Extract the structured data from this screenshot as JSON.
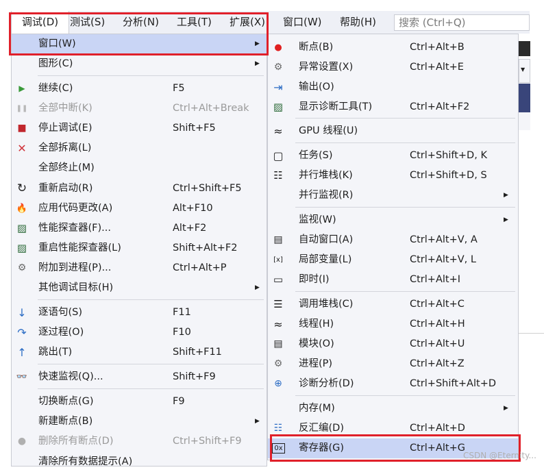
{
  "menubar": {
    "items": [
      {
        "label": "调试(D)"
      },
      {
        "label": "测试(S)"
      },
      {
        "label": "分析(N)"
      },
      {
        "label": "工具(T)"
      },
      {
        "label": "扩展(X)"
      },
      {
        "label": "窗口(W)"
      },
      {
        "label": "帮助(H)"
      }
    ],
    "search_placeholder": "搜索 (Ctrl+Q)"
  },
  "debug_menu": {
    "items": [
      {
        "label": "窗口(W)",
        "shortcut": "",
        "icon": "",
        "submenu": true
      },
      {
        "label": "图形(C)",
        "shortcut": "",
        "icon": "",
        "submenu": true
      },
      {
        "label": "继续(C)",
        "shortcut": "F5",
        "icon": "play-icon"
      },
      {
        "label": "全部中断(K)",
        "shortcut": "Ctrl+Alt+Break",
        "icon": "pause-icon"
      },
      {
        "label": "停止调试(E)",
        "shortcut": "Shift+F5",
        "icon": "stop-icon"
      },
      {
        "label": "全部拆离(L)",
        "shortcut": "",
        "icon": "close-icon"
      },
      {
        "label": "全部终止(M)",
        "shortcut": "",
        "icon": ""
      },
      {
        "label": "重新启动(R)",
        "shortcut": "Ctrl+Shift+F5",
        "icon": "restart-icon"
      },
      {
        "label": "应用代码更改(A)",
        "shortcut": "Alt+F10",
        "icon": "hot-reload-icon"
      },
      {
        "label": "性能探查器(F)...",
        "shortcut": "Alt+F2",
        "icon": "profiler-icon"
      },
      {
        "label": "重启性能探查器(L)",
        "shortcut": "Shift+Alt+F2",
        "icon": "profiler-restart-icon"
      },
      {
        "label": "附加到进程(P)...",
        "shortcut": "Ctrl+Alt+P",
        "icon": "attach-process-icon"
      },
      {
        "label": "其他调试目标(H)",
        "shortcut": "",
        "icon": "",
        "submenu": true
      },
      {
        "label": "逐语句(S)",
        "shortcut": "F11",
        "icon": "step-into-icon"
      },
      {
        "label": "逐过程(O)",
        "shortcut": "F10",
        "icon": "step-over-icon"
      },
      {
        "label": "跳出(T)",
        "shortcut": "Shift+F11",
        "icon": "step-out-icon"
      },
      {
        "label": "快速监视(Q)...",
        "shortcut": "Shift+F9",
        "icon": "quick-watch-icon"
      },
      {
        "label": "切换断点(G)",
        "shortcut": "F9",
        "icon": ""
      },
      {
        "label": "新建断点(B)",
        "shortcut": "",
        "icon": "",
        "submenu": true
      },
      {
        "label": "删除所有断点(D)",
        "shortcut": "Ctrl+Shift+F9",
        "icon": "delete-breakpoints-icon"
      },
      {
        "label": "清除所有数据提示(A)",
        "shortcut": "",
        "icon": ""
      }
    ]
  },
  "window_submenu": {
    "items": [
      {
        "label": "断点(B)",
        "shortcut": "Ctrl+Alt+B",
        "icon": "breakpoint-icon"
      },
      {
        "label": "异常设置(X)",
        "shortcut": "Ctrl+Alt+E",
        "icon": "exception-settings-icon"
      },
      {
        "label": "输出(O)",
        "shortcut": "",
        "icon": "output-icon"
      },
      {
        "label": "显示诊断工具(T)",
        "shortcut": "Ctrl+Alt+F2",
        "icon": "diagnostic-tools-icon"
      },
      {
        "label": "GPU 线程(U)",
        "shortcut": "",
        "icon": "gpu-threads-icon"
      },
      {
        "label": "任务(S)",
        "shortcut": "Ctrl+Shift+D, K",
        "icon": "tasks-icon"
      },
      {
        "label": "并行堆栈(K)",
        "shortcut": "Ctrl+Shift+D, S",
        "icon": "parallel-stacks-icon"
      },
      {
        "label": "并行监视(R)",
        "shortcut": "",
        "icon": "",
        "submenu": true
      },
      {
        "label": "监视(W)",
        "shortcut": "",
        "icon": "",
        "submenu": true
      },
      {
        "label": "自动窗口(A)",
        "shortcut": "Ctrl+Alt+V, A",
        "icon": "autos-icon"
      },
      {
        "label": "局部变量(L)",
        "shortcut": "Ctrl+Alt+V, L",
        "icon": "locals-icon"
      },
      {
        "label": "即时(I)",
        "shortcut": "Ctrl+Alt+I",
        "icon": "immediate-icon"
      },
      {
        "label": "调用堆栈(C)",
        "shortcut": "Ctrl+Alt+C",
        "icon": "call-stack-icon"
      },
      {
        "label": "线程(H)",
        "shortcut": "Ctrl+Alt+H",
        "icon": "threads-icon"
      },
      {
        "label": "模块(O)",
        "shortcut": "Ctrl+Alt+U",
        "icon": "modules-icon"
      },
      {
        "label": "进程(P)",
        "shortcut": "Ctrl+Alt+Z",
        "icon": "processes-icon"
      },
      {
        "label": "诊断分析(D)",
        "shortcut": "Ctrl+Shift+Alt+D",
        "icon": "diagnostics-analysis-icon"
      },
      {
        "label": "内存(M)",
        "shortcut": "",
        "icon": "",
        "submenu": true
      },
      {
        "label": "反汇编(D)",
        "shortcut": "Ctrl+Alt+D",
        "icon": "disassembly-icon"
      },
      {
        "label": "寄存器(G)",
        "shortcut": "Ctrl+Alt+G",
        "icon": "registers-icon"
      }
    ]
  },
  "watermark": "CSDN @Eternity..."
}
